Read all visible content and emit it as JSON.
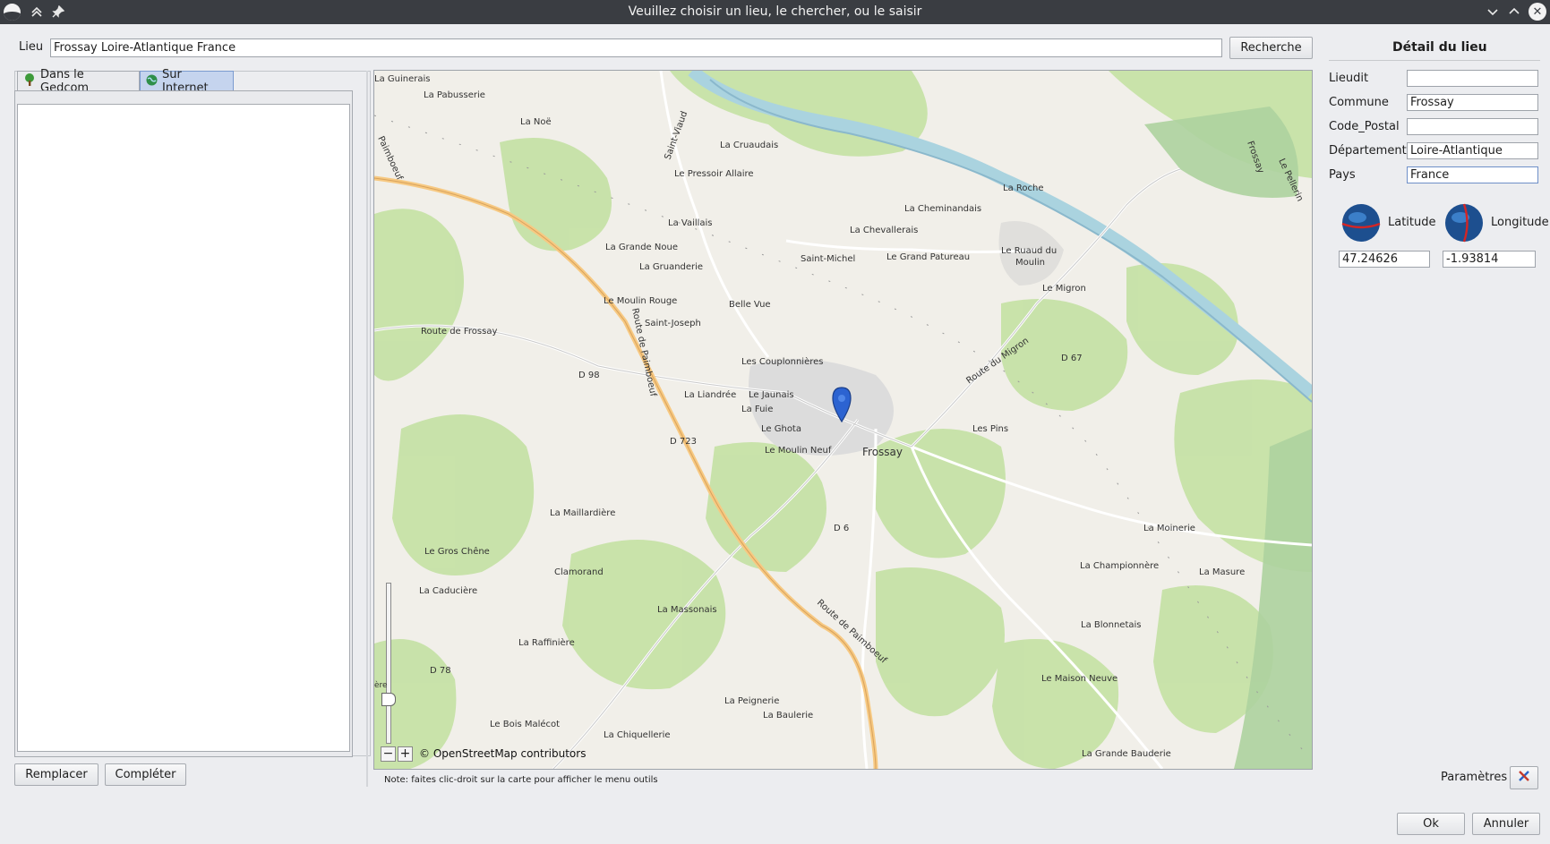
{
  "window": {
    "title": "Veuillez choisir un lieu, le chercher, ou le saisir"
  },
  "search": {
    "label": "Lieu",
    "value": "Frossay Loire-Atlantique France",
    "button": "Recherche"
  },
  "tabs": [
    {
      "label": "Dans le Gedcom",
      "icon": "tree-icon"
    },
    {
      "label": "Sur Internet",
      "icon": "globe-icon"
    }
  ],
  "left_buttons": {
    "replace": "Remplacer",
    "complete": "Compléter"
  },
  "map": {
    "attribution": "© OpenStreetMap contributors",
    "note": "Note: faites clic-droit sur la carte pour afficher le menu outils",
    "zoom_out": "−",
    "zoom_in": "+",
    "slider_fragment": "ère",
    "places": [
      "La Guinerais",
      "La Pabusserie",
      "La Noë",
      "La Cruaudais",
      "Le Pressoir Allaire",
      "La Roche",
      "La Cheminandais",
      "La Chevallerais",
      "La Vaillais",
      "La Grande Noue",
      "La Gruanderie",
      "Saint-Michel",
      "Le Grand Patureau",
      "Le Ruaud du",
      "Moulin",
      "Le Migron",
      "Le Moulin Rouge",
      "Belle Vue",
      "Saint-Joseph",
      "Route de Frossay",
      "D 98",
      "Les Couplonnières",
      "D 67",
      "Route du Migron",
      "La Liandrée",
      "Le Jaunais",
      "La Fuie",
      "Le Ghota",
      "Les Pins",
      "D 723",
      "Le Moulin Neuf",
      "Frossay",
      "D 6",
      "La Maillardière",
      "La Moinerie",
      "Le Gros Chêne",
      "Clamorand",
      "La Championnère",
      "La Masure",
      "La Caducière",
      "La Massonais",
      "La Blonnetais",
      "La Raffinière",
      "D 78",
      "Route de Paimboeuf",
      "Le Maison Neuve",
      "La Peignerie",
      "La Baulerie",
      "Le Bois Malécot",
      "La Chiquellerie",
      "La Grande Bauderie",
      "Saint-Viaud",
      "Frossay",
      "Le Pellerin",
      "Route de Paimboeuf",
      "Paimboeuf"
    ]
  },
  "detail": {
    "title": "Détail du lieu",
    "fields": [
      {
        "label": "Lieudit",
        "value": ""
      },
      {
        "label": "Commune",
        "value": "Frossay"
      },
      {
        "label": "Code_Postal",
        "value": ""
      },
      {
        "label": "Département",
        "value": "Loire-Atlantique"
      },
      {
        "label": "Pays",
        "value": "France"
      }
    ],
    "latitude_label": "Latitude",
    "latitude": "47.24626",
    "longitude_label": "Longitude",
    "longitude": "-1.93814",
    "params_label": "Paramètres"
  },
  "footer": {
    "ok": "Ok",
    "cancel": "Annuler"
  },
  "colors": {
    "titlebar": "#3a3d42",
    "selection": "#c5d4ee",
    "marker": "#2c63d1"
  }
}
